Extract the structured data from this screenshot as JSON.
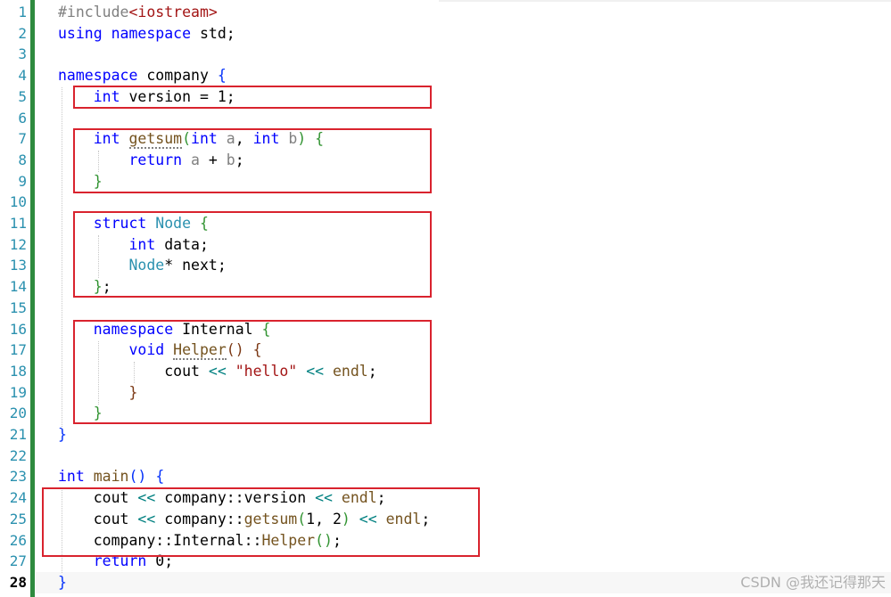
{
  "editor": {
    "line_numbers": [
      "1",
      "2",
      "3",
      "4",
      "5",
      "6",
      "7",
      "8",
      "9",
      "10",
      "11",
      "12",
      "13",
      "14",
      "15",
      "16",
      "17",
      "18",
      "19",
      "20",
      "21",
      "22",
      "23",
      "24",
      "25",
      "26",
      "27",
      "28"
    ],
    "current_line": "28",
    "lines": [
      [
        {
          "t": "#include",
          "c": "pp"
        },
        {
          "t": "<iostream>",
          "c": "inc"
        }
      ],
      [
        {
          "t": "using",
          "c": "kw"
        },
        {
          "t": " "
        },
        {
          "t": "namespace",
          "c": "kw"
        },
        {
          "t": " std;"
        }
      ],
      [],
      [
        {
          "t": "namespace",
          "c": "kw"
        },
        {
          "t": " company "
        },
        {
          "t": "{",
          "c": "br1"
        }
      ],
      [
        {
          "t": "    "
        },
        {
          "t": "int",
          "c": "kw"
        },
        {
          "t": " version = 1;"
        }
      ],
      [],
      [
        {
          "t": "    "
        },
        {
          "t": "int",
          "c": "kw"
        },
        {
          "t": " "
        },
        {
          "t": "getsum",
          "c": "fn squig"
        },
        {
          "t": "(",
          "c": "br2"
        },
        {
          "t": "int",
          "c": "kw"
        },
        {
          "t": " "
        },
        {
          "t": "a",
          "c": "pr"
        },
        {
          "t": ", "
        },
        {
          "t": "int",
          "c": "kw"
        },
        {
          "t": " "
        },
        {
          "t": "b",
          "c": "pr"
        },
        {
          "t": ")",
          "c": "br2"
        },
        {
          "t": " "
        },
        {
          "t": "{",
          "c": "br2"
        }
      ],
      [
        {
          "t": "        "
        },
        {
          "t": "return",
          "c": "kw"
        },
        {
          "t": " "
        },
        {
          "t": "a",
          "c": "pr"
        },
        {
          "t": " + "
        },
        {
          "t": "b",
          "c": "pr"
        },
        {
          "t": ";"
        }
      ],
      [
        {
          "t": "    "
        },
        {
          "t": "}",
          "c": "br2"
        }
      ],
      [],
      [
        {
          "t": "    "
        },
        {
          "t": "struct",
          "c": "kw"
        },
        {
          "t": " "
        },
        {
          "t": "Node",
          "c": "ty"
        },
        {
          "t": " "
        },
        {
          "t": "{",
          "c": "br2"
        }
      ],
      [
        {
          "t": "        "
        },
        {
          "t": "int",
          "c": "kw"
        },
        {
          "t": " data;"
        }
      ],
      [
        {
          "t": "        "
        },
        {
          "t": "Node",
          "c": "ty"
        },
        {
          "t": "* next;"
        }
      ],
      [
        {
          "t": "    "
        },
        {
          "t": "}",
          "c": "br2"
        },
        {
          "t": ";"
        }
      ],
      [],
      [
        {
          "t": "    "
        },
        {
          "t": "namespace",
          "c": "kw"
        },
        {
          "t": " Internal "
        },
        {
          "t": "{",
          "c": "br2"
        }
      ],
      [
        {
          "t": "        "
        },
        {
          "t": "void",
          "c": "kw"
        },
        {
          "t": " "
        },
        {
          "t": "Helper",
          "c": "fn squig"
        },
        {
          "t": "()",
          "c": "br3"
        },
        {
          "t": " "
        },
        {
          "t": "{",
          "c": "br3"
        }
      ],
      [
        {
          "t": "            cout "
        },
        {
          "t": "<<",
          "c": "op"
        },
        {
          "t": " "
        },
        {
          "t": "\"hello\"",
          "c": "str"
        },
        {
          "t": " "
        },
        {
          "t": "<<",
          "c": "op"
        },
        {
          "t": " "
        },
        {
          "t": "endl",
          "c": "fn"
        },
        {
          "t": ";"
        }
      ],
      [
        {
          "t": "        "
        },
        {
          "t": "}",
          "c": "br3"
        }
      ],
      [
        {
          "t": "    "
        },
        {
          "t": "}",
          "c": "br2"
        }
      ],
      [
        {
          "t": "}",
          "c": "br1"
        }
      ],
      [],
      [
        {
          "t": "int",
          "c": "kw"
        },
        {
          "t": " "
        },
        {
          "t": "main",
          "c": "fn"
        },
        {
          "t": "()",
          "c": "br1"
        },
        {
          "t": " "
        },
        {
          "t": "{",
          "c": "br1"
        }
      ],
      [
        {
          "t": "    cout "
        },
        {
          "t": "<<",
          "c": "op"
        },
        {
          "t": " company::version "
        },
        {
          "t": "<<",
          "c": "op"
        },
        {
          "t": " "
        },
        {
          "t": "endl",
          "c": "fn"
        },
        {
          "t": ";"
        }
      ],
      [
        {
          "t": "    cout "
        },
        {
          "t": "<<",
          "c": "op"
        },
        {
          "t": " company::"
        },
        {
          "t": "getsum",
          "c": "fn"
        },
        {
          "t": "(",
          "c": "br2"
        },
        {
          "t": "1, 2"
        },
        {
          "t": ")",
          "c": "br2"
        },
        {
          "t": " "
        },
        {
          "t": "<<",
          "c": "op"
        },
        {
          "t": " "
        },
        {
          "t": "endl",
          "c": "fn"
        },
        {
          "t": ";"
        }
      ],
      [
        {
          "t": "    company::Internal::"
        },
        {
          "t": "Helper",
          "c": "fn"
        },
        {
          "t": "()",
          "c": "br2"
        },
        {
          "t": ";"
        }
      ],
      [
        {
          "t": "    "
        },
        {
          "t": "return",
          "c": "kw"
        },
        {
          "t": " 0;"
        }
      ],
      [
        {
          "t": "}",
          "c": "br1"
        }
      ]
    ]
  },
  "colors": {
    "keyword": "#0000ff",
    "type": "#2b91af",
    "string": "#a31515",
    "function": "#74531f",
    "highlight_box": "#d9232e",
    "change_bar": "#2e8b3f"
  },
  "watermark": "CSDN @我还记得那天"
}
